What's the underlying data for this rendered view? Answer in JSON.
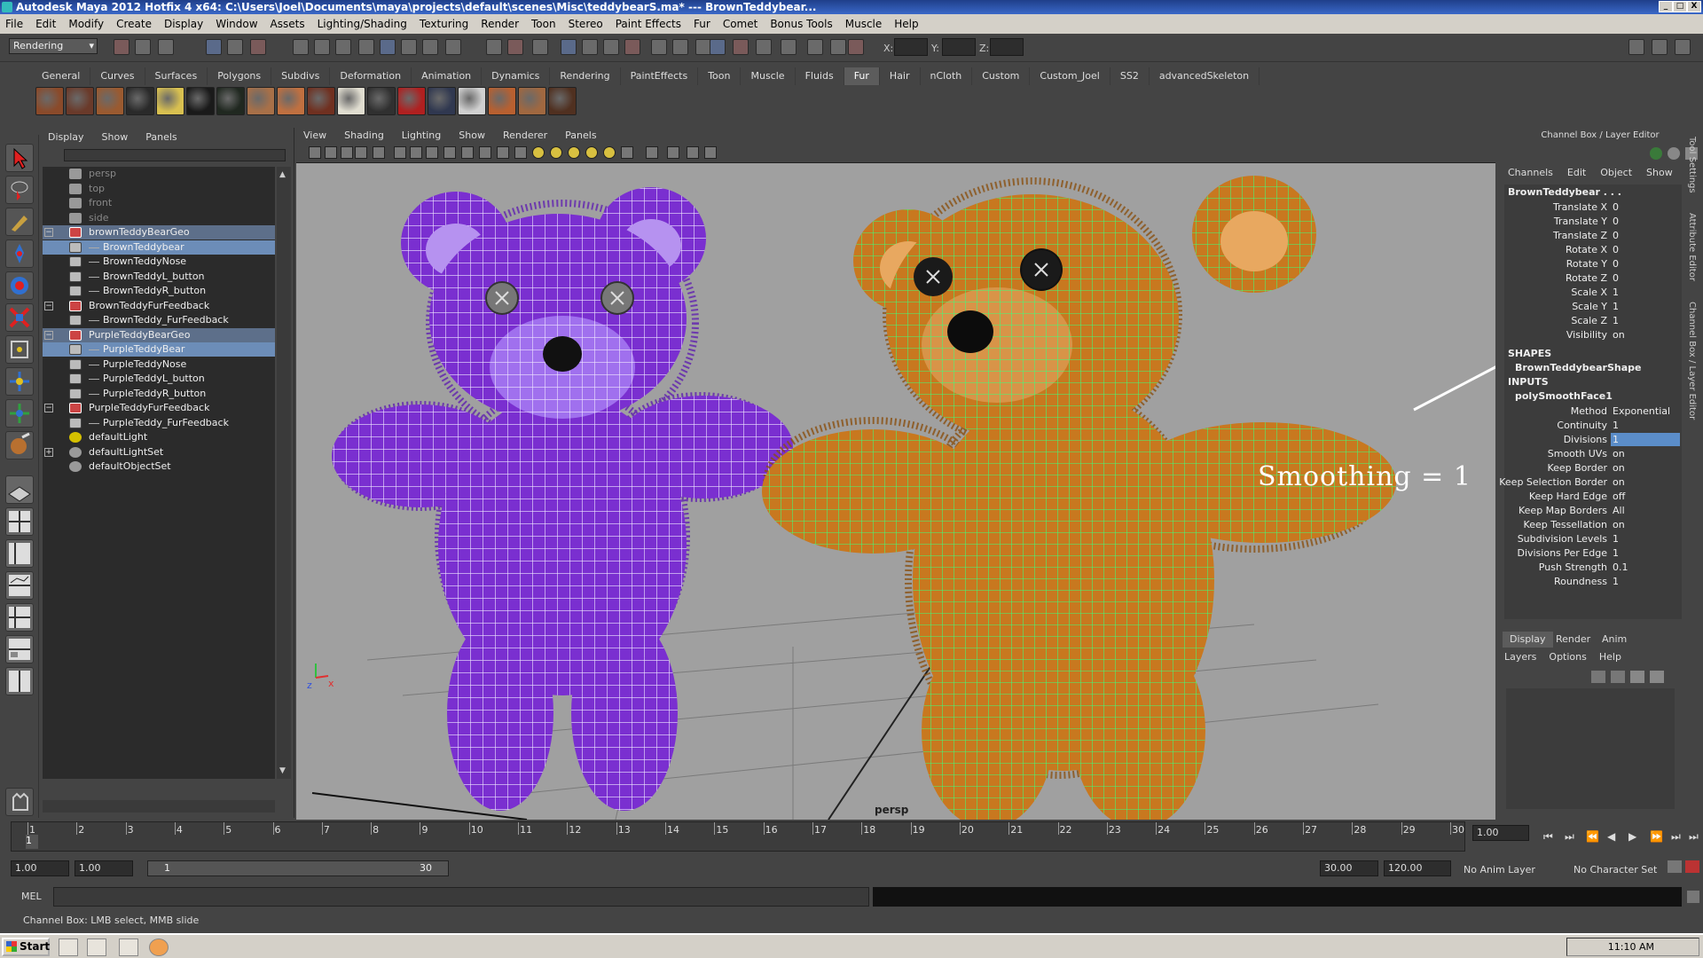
{
  "window": {
    "title": "Autodesk Maya 2012 Hotfix 4 x64: C:\\Users\\Joel\\Documents\\maya\\projects\\default\\scenes\\Misc\\teddybearS.ma*   ---   BrownTeddybear...",
    "controls": [
      "_",
      "□",
      "X"
    ]
  },
  "menubar": [
    "File",
    "Edit",
    "Modify",
    "Create",
    "Display",
    "Window",
    "Assets",
    "Lighting/Shading",
    "Texturing",
    "Render",
    "Toon",
    "Stereo",
    "Paint Effects",
    "Fur",
    "Comet",
    "Bonus Tools",
    "Muscle",
    "Help"
  ],
  "status": {
    "menuset": "Rendering",
    "x_label": "X:",
    "y_label": "Y:",
    "z_label": "Z:"
  },
  "shelf": {
    "tabs": [
      "General",
      "Curves",
      "Surfaces",
      "Polygons",
      "Subdivs",
      "Deformation",
      "Animation",
      "Dynamics",
      "Rendering",
      "PaintEffects",
      "Toon",
      "Muscle",
      "Fluids",
      "Fur",
      "Hair",
      "nCloth",
      "Custom",
      "Custom_Joel",
      "SS2",
      "advancedSkeleton"
    ],
    "active_tab": "Fur",
    "icon_colors": [
      "#8a4a2a",
      "#6a3a2a",
      "#9a5a30",
      "#2a2a2a",
      "#d8c050",
      "#1a1a1a",
      "#202820",
      "#a87048",
      "#c07040",
      "#703020",
      "#e0ddd0",
      "#303030",
      "#b02020",
      "#303850",
      "#d0d0d0",
      "#b86030",
      "#a06840",
      "#503020"
    ]
  },
  "outliner": {
    "menu": [
      "Display",
      "Show",
      "Panels"
    ],
    "rows": [
      {
        "label": "persp",
        "icon": "camera-icon",
        "indent": 0,
        "style": "dim"
      },
      {
        "label": "top",
        "icon": "camera-icon",
        "indent": 0,
        "style": "dim"
      },
      {
        "label": "front",
        "icon": "camera-icon",
        "indent": 0,
        "style": "dim"
      },
      {
        "label": "side",
        "icon": "camera-icon",
        "indent": 0,
        "style": "dim"
      },
      {
        "label": "brownTeddyBearGeo",
        "icon": "group-icon",
        "indent": 0,
        "style": "hl",
        "expander": "−"
      },
      {
        "label": "BrownTeddybear",
        "icon": "mesh-icon",
        "indent": 1,
        "style": "selr"
      },
      {
        "label": "BrownTeddyNose",
        "icon": "mesh-icon",
        "indent": 1,
        "style": ""
      },
      {
        "label": "BrownTeddyL_button",
        "icon": "mesh-icon",
        "indent": 1,
        "style": ""
      },
      {
        "label": "BrownTeddyR_button",
        "icon": "mesh-icon",
        "indent": 1,
        "style": ""
      },
      {
        "label": "BrownTeddyFurFeedback",
        "icon": "group-icon",
        "indent": 0,
        "style": "",
        "expander": "−"
      },
      {
        "label": "BrownTeddy_FurFeedback",
        "icon": "mesh-icon",
        "indent": 1,
        "style": ""
      },
      {
        "label": "PurpleTeddyBearGeo",
        "icon": "group-icon",
        "indent": 0,
        "style": "hl",
        "expander": "−"
      },
      {
        "label": "PurpleTeddyBear",
        "icon": "mesh-icon",
        "indent": 1,
        "style": "selr"
      },
      {
        "label": "PurpleTeddyNose",
        "icon": "mesh-icon",
        "indent": 1,
        "style": ""
      },
      {
        "label": "PurpleTeddyL_button",
        "icon": "mesh-icon",
        "indent": 1,
        "style": ""
      },
      {
        "label": "PurpleTeddyR_button",
        "icon": "mesh-icon",
        "indent": 1,
        "style": ""
      },
      {
        "label": "PurpleTeddyFurFeedback",
        "icon": "group-icon",
        "indent": 0,
        "style": "",
        "expander": "−"
      },
      {
        "label": "PurpleTeddy_FurFeedback",
        "icon": "mesh-icon",
        "indent": 1,
        "style": ""
      },
      {
        "label": "defaultLight",
        "icon": "light-icon",
        "indent": 0,
        "style": ""
      },
      {
        "label": "defaultLightSet",
        "icon": "set-icon",
        "indent": 0,
        "style": "",
        "expander": "+"
      },
      {
        "label": "defaultObjectSet",
        "icon": "set-icon",
        "indent": 0,
        "style": ""
      }
    ]
  },
  "viewport": {
    "menu": [
      "View",
      "Shading",
      "Lighting",
      "Show",
      "Renderer",
      "Panels"
    ],
    "camera_label": "persp",
    "annotation": "Smoothing = 1",
    "axis_labels": {
      "z": "z",
      "x": "x"
    },
    "colors": {
      "purple": "#7a2fd0",
      "purple_wire": "#e8e0ff",
      "brown": "#c8781f",
      "brown_wire": "#40ff70"
    }
  },
  "channel_box": {
    "title": "Channel Box / Layer Editor",
    "menu": [
      "Channels",
      "Edit",
      "Object",
      "Show"
    ],
    "object_name": "BrownTeddybear . . .",
    "attributes": [
      {
        "label": "Translate X",
        "value": "0"
      },
      {
        "label": "Translate Y",
        "value": "0"
      },
      {
        "label": "Translate Z",
        "value": "0"
      },
      {
        "label": "Rotate X",
        "value": "0"
      },
      {
        "label": "Rotate Y",
        "value": "0"
      },
      {
        "label": "Rotate Z",
        "value": "0"
      },
      {
        "label": "Scale X",
        "value": "1"
      },
      {
        "label": "Scale Y",
        "value": "1"
      },
      {
        "label": "Scale Z",
        "value": "1"
      },
      {
        "label": "Visibility",
        "value": "on"
      }
    ],
    "shapes_header": "SHAPES",
    "shape_name": "BrownTeddybearShape",
    "inputs_header": "INPUTS",
    "input_name": "polySmoothFace1",
    "input_attributes": [
      {
        "label": "Method",
        "value": "Exponential"
      },
      {
        "label": "Continuity",
        "value": "1"
      },
      {
        "label": "Divisions",
        "value": "1",
        "highlight": true
      },
      {
        "label": "Smooth UVs",
        "value": "on"
      },
      {
        "label": "Keep Border",
        "value": "on"
      },
      {
        "label": "Keep Selection Border",
        "value": "on"
      },
      {
        "label": "Keep Hard Edge",
        "value": "off"
      },
      {
        "label": "Keep Map Borders",
        "value": "All"
      },
      {
        "label": "Keep Tessellation",
        "value": "on"
      },
      {
        "label": "Subdivision Levels",
        "value": "1"
      },
      {
        "label": "Divisions Per Edge",
        "value": "1"
      },
      {
        "label": "Push Strength",
        "value": "0.1"
      },
      {
        "label": "Roundness",
        "value": "1"
      }
    ],
    "side_tabs": [
      "Tool Settings",
      "Attribute Editor",
      "Channel Box / Layer Editor"
    ]
  },
  "layer_editor": {
    "tabs": [
      "Display",
      "Render",
      "Anim"
    ],
    "menu": [
      "Layers",
      "Options",
      "Help"
    ]
  },
  "timeline": {
    "start": 1,
    "end": 30,
    "current_frame": "1",
    "current_time_field": "1.00"
  },
  "range": {
    "start_time": "1.00",
    "playback_start": "1.00",
    "slider_start": "1",
    "slider_end": "30",
    "playback_end": "30.00",
    "end_time": "120.00",
    "anim_layer": "No Anim Layer",
    "character_set": "No Character Set"
  },
  "mel_label": "MEL",
  "help_line": "Channel Box: LMB select, MMB slide",
  "taskbar": {
    "start": "Start",
    "clock": "11:10 AM"
  }
}
